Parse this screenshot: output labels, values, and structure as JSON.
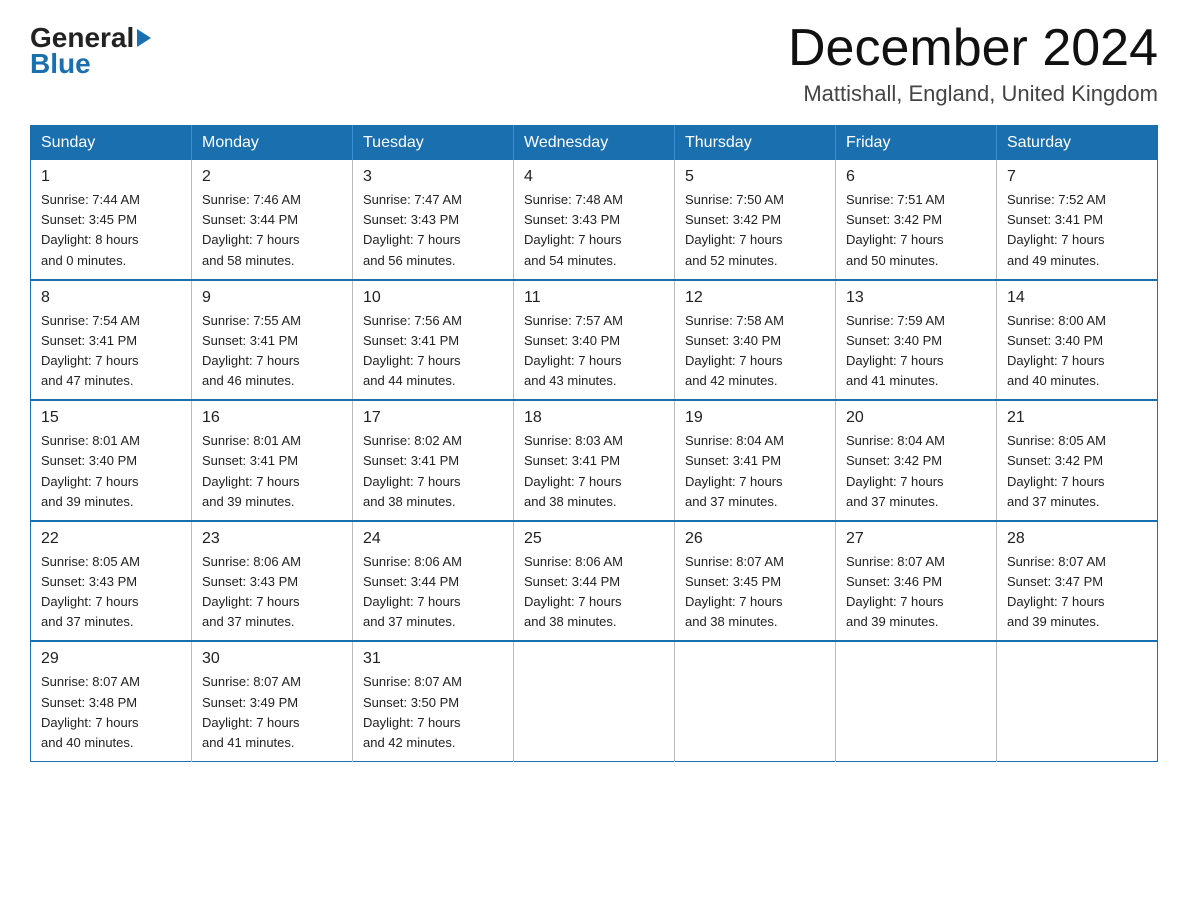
{
  "header": {
    "logo_general": "General",
    "logo_blue": "Blue",
    "month_year": "December 2024",
    "location": "Mattishall, England, United Kingdom"
  },
  "days_header": [
    "Sunday",
    "Monday",
    "Tuesday",
    "Wednesday",
    "Thursday",
    "Friday",
    "Saturday"
  ],
  "weeks": [
    [
      {
        "day": "1",
        "sunrise": "7:44 AM",
        "sunset": "3:45 PM",
        "daylight": "8 hours and 0 minutes."
      },
      {
        "day": "2",
        "sunrise": "7:46 AM",
        "sunset": "3:44 PM",
        "daylight": "7 hours and 58 minutes."
      },
      {
        "day": "3",
        "sunrise": "7:47 AM",
        "sunset": "3:43 PM",
        "daylight": "7 hours and 56 minutes."
      },
      {
        "day": "4",
        "sunrise": "7:48 AM",
        "sunset": "3:43 PM",
        "daylight": "7 hours and 54 minutes."
      },
      {
        "day": "5",
        "sunrise": "7:50 AM",
        "sunset": "3:42 PM",
        "daylight": "7 hours and 52 minutes."
      },
      {
        "day": "6",
        "sunrise": "7:51 AM",
        "sunset": "3:42 PM",
        "daylight": "7 hours and 50 minutes."
      },
      {
        "day": "7",
        "sunrise": "7:52 AM",
        "sunset": "3:41 PM",
        "daylight": "7 hours and 49 minutes."
      }
    ],
    [
      {
        "day": "8",
        "sunrise": "7:54 AM",
        "sunset": "3:41 PM",
        "daylight": "7 hours and 47 minutes."
      },
      {
        "day": "9",
        "sunrise": "7:55 AM",
        "sunset": "3:41 PM",
        "daylight": "7 hours and 46 minutes."
      },
      {
        "day": "10",
        "sunrise": "7:56 AM",
        "sunset": "3:41 PM",
        "daylight": "7 hours and 44 minutes."
      },
      {
        "day": "11",
        "sunrise": "7:57 AM",
        "sunset": "3:40 PM",
        "daylight": "7 hours and 43 minutes."
      },
      {
        "day": "12",
        "sunrise": "7:58 AM",
        "sunset": "3:40 PM",
        "daylight": "7 hours and 42 minutes."
      },
      {
        "day": "13",
        "sunrise": "7:59 AM",
        "sunset": "3:40 PM",
        "daylight": "7 hours and 41 minutes."
      },
      {
        "day": "14",
        "sunrise": "8:00 AM",
        "sunset": "3:40 PM",
        "daylight": "7 hours and 40 minutes."
      }
    ],
    [
      {
        "day": "15",
        "sunrise": "8:01 AM",
        "sunset": "3:40 PM",
        "daylight": "7 hours and 39 minutes."
      },
      {
        "day": "16",
        "sunrise": "8:01 AM",
        "sunset": "3:41 PM",
        "daylight": "7 hours and 39 minutes."
      },
      {
        "day": "17",
        "sunrise": "8:02 AM",
        "sunset": "3:41 PM",
        "daylight": "7 hours and 38 minutes."
      },
      {
        "day": "18",
        "sunrise": "8:03 AM",
        "sunset": "3:41 PM",
        "daylight": "7 hours and 38 minutes."
      },
      {
        "day": "19",
        "sunrise": "8:04 AM",
        "sunset": "3:41 PM",
        "daylight": "7 hours and 37 minutes."
      },
      {
        "day": "20",
        "sunrise": "8:04 AM",
        "sunset": "3:42 PM",
        "daylight": "7 hours and 37 minutes."
      },
      {
        "day": "21",
        "sunrise": "8:05 AM",
        "sunset": "3:42 PM",
        "daylight": "7 hours and 37 minutes."
      }
    ],
    [
      {
        "day": "22",
        "sunrise": "8:05 AM",
        "sunset": "3:43 PM",
        "daylight": "7 hours and 37 minutes."
      },
      {
        "day": "23",
        "sunrise": "8:06 AM",
        "sunset": "3:43 PM",
        "daylight": "7 hours and 37 minutes."
      },
      {
        "day": "24",
        "sunrise": "8:06 AM",
        "sunset": "3:44 PM",
        "daylight": "7 hours and 37 minutes."
      },
      {
        "day": "25",
        "sunrise": "8:06 AM",
        "sunset": "3:44 PM",
        "daylight": "7 hours and 38 minutes."
      },
      {
        "day": "26",
        "sunrise": "8:07 AM",
        "sunset": "3:45 PM",
        "daylight": "7 hours and 38 minutes."
      },
      {
        "day": "27",
        "sunrise": "8:07 AM",
        "sunset": "3:46 PM",
        "daylight": "7 hours and 39 minutes."
      },
      {
        "day": "28",
        "sunrise": "8:07 AM",
        "sunset": "3:47 PM",
        "daylight": "7 hours and 39 minutes."
      }
    ],
    [
      {
        "day": "29",
        "sunrise": "8:07 AM",
        "sunset": "3:48 PM",
        "daylight": "7 hours and 40 minutes."
      },
      {
        "day": "30",
        "sunrise": "8:07 AM",
        "sunset": "3:49 PM",
        "daylight": "7 hours and 41 minutes."
      },
      {
        "day": "31",
        "sunrise": "8:07 AM",
        "sunset": "3:50 PM",
        "daylight": "7 hours and 42 minutes."
      },
      null,
      null,
      null,
      null
    ]
  ],
  "labels": {
    "sunrise": "Sunrise:",
    "sunset": "Sunset:",
    "daylight": "Daylight:"
  }
}
